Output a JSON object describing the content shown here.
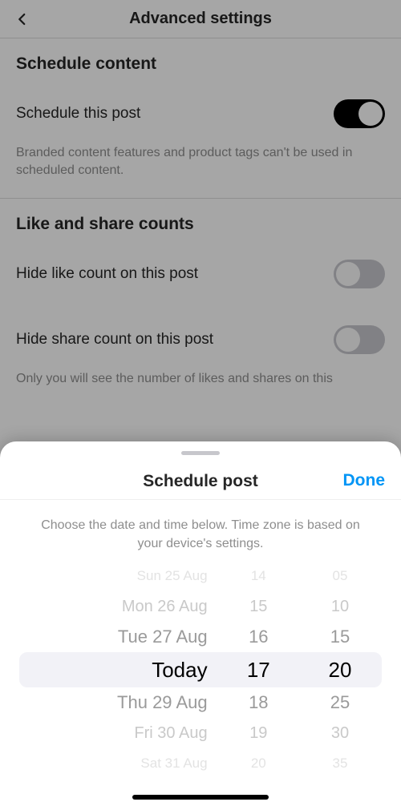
{
  "header": {
    "title": "Advanced settings"
  },
  "schedule_section": {
    "title": "Schedule content",
    "toggle_label": "Schedule this post",
    "toggle_on": true,
    "description": "Branded content features and product tags can't be used in scheduled content."
  },
  "counts_section": {
    "title": "Like and share counts",
    "hide_like_label": "Hide like count on this post",
    "hide_like_on": false,
    "hide_share_label": "Hide share count on this post",
    "hide_share_on": false,
    "description": "Only you will see the number of likes and shares on this"
  },
  "sheet": {
    "title": "Schedule post",
    "done_label": "Done",
    "description": "Choose the date and time below. Time zone is based on your device's settings.",
    "picker": {
      "dates": [
        "Sun 25 Aug",
        "Mon 26 Aug",
        "Tue 27 Aug",
        "Today",
        "Thu 29 Aug",
        "Fri 30 Aug",
        "Sat 31 Aug"
      ],
      "hours": [
        "14",
        "15",
        "16",
        "17",
        "18",
        "19",
        "20"
      ],
      "minutes": [
        "05",
        "10",
        "15",
        "20",
        "25",
        "30",
        "35"
      ],
      "selected_index": 3
    }
  }
}
